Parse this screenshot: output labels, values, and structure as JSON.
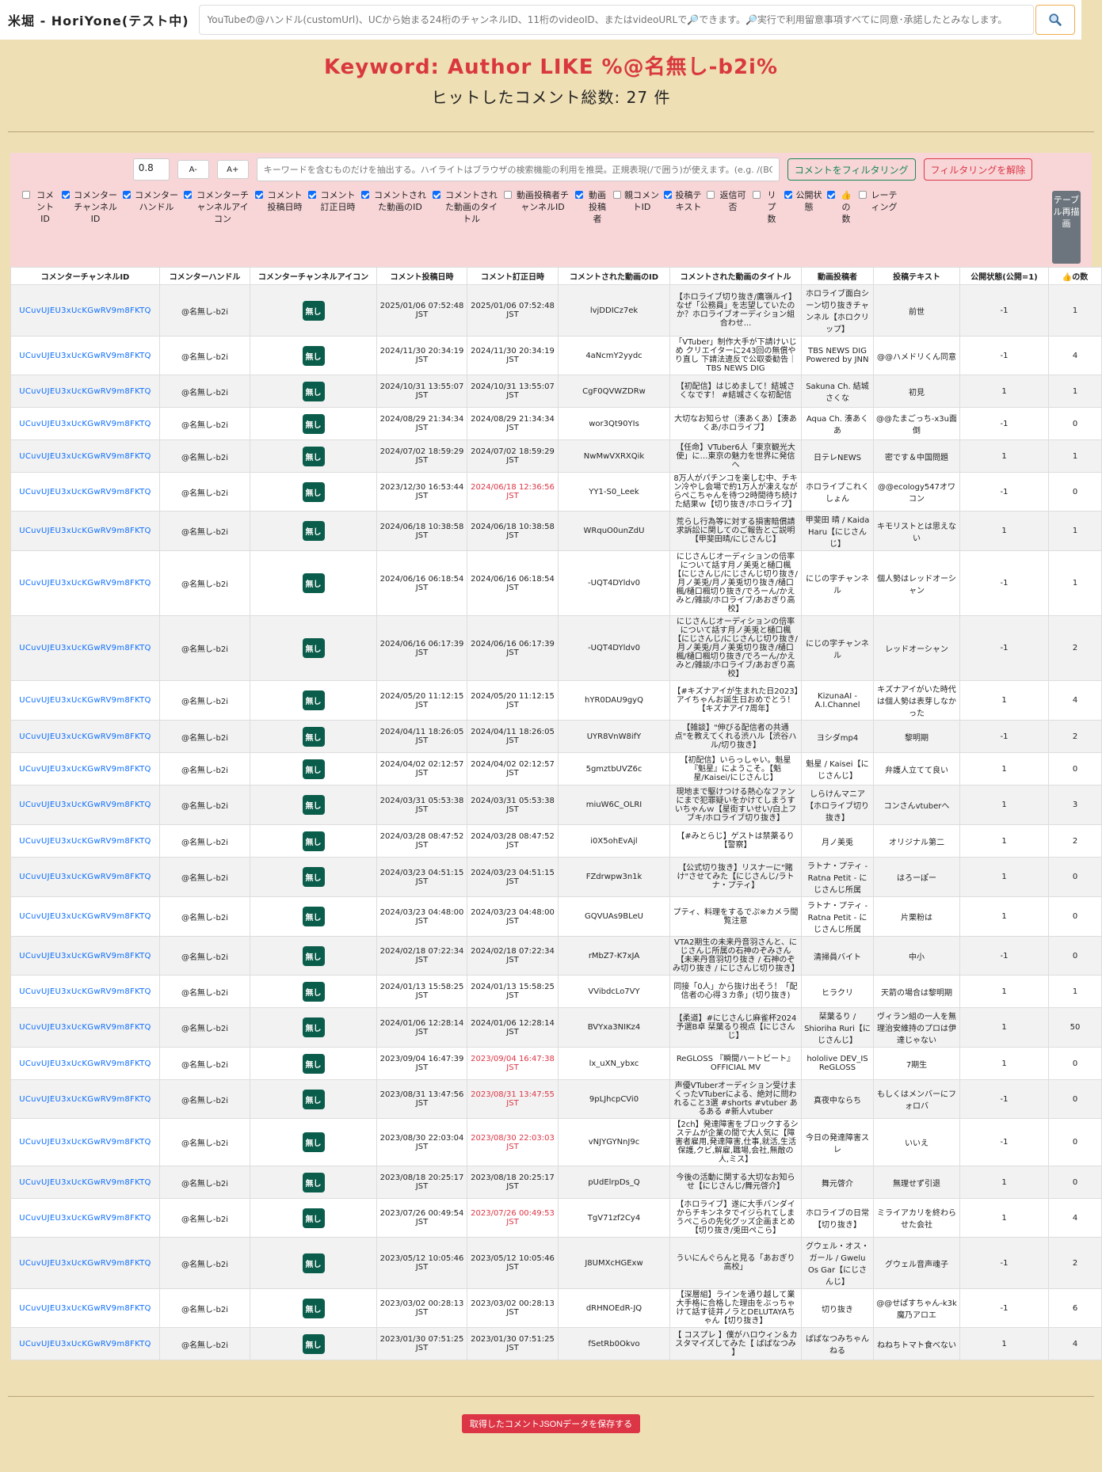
{
  "app": {
    "title": "米堀 - HoriYone(テスト中)",
    "search_placeholder": "YouTubeの@ハンドル(customUrl)、UCから始まる24桁のチャンネルID、11桁のvideoID、またはvideoURLで🔎できます。🔎実行で利用留意事項すべてに同意･承諾したとみなします。"
  },
  "heading": {
    "keyword": "Keyword: Author LIKE %@名無し-b2i%",
    "count": "ヒットしたコメント総数: 27 件"
  },
  "filter": {
    "zoom_value": "0.8",
    "zoom_out_label": "A-",
    "zoom_in_label": "A+",
    "keyword_placeholder": "キーワードを含むものだけを抽出する。ハイライトはブラウザの検索機能の利用を推奨。正規表現(/で囲う)が使えます。(e.g. /(BC)/",
    "filter_button": "コメントをフィルタリング",
    "clear_button": "フィルタリングを解除",
    "redraw_button": "テーブル再描画"
  },
  "columns": [
    {
      "label": "コメントID",
      "checked": false
    },
    {
      "label": "コメンターチャンネルID",
      "checked": true
    },
    {
      "label": "コメンターハンドル",
      "checked": true
    },
    {
      "label": "コメンターチャンネルアイコン",
      "checked": true
    },
    {
      "label": "コメント投稿日時",
      "checked": true
    },
    {
      "label": "コメント訂正日時",
      "checked": true
    },
    {
      "label": "コメントされた動画のID",
      "checked": true
    },
    {
      "label": "コメントされた動画のタイトル",
      "checked": true
    },
    {
      "label": "動画投稿者チャンネルID",
      "checked": false
    },
    {
      "label": "動画投稿者",
      "checked": true
    },
    {
      "label": "親コメントID",
      "checked": false
    },
    {
      "label": "投稿テキスト",
      "checked": true
    },
    {
      "label": "返信可否",
      "checked": false
    },
    {
      "label": "リプ数",
      "checked": false
    },
    {
      "label": "公開状態",
      "checked": true
    },
    {
      "label": "👍の数",
      "checked": true
    },
    {
      "label": "レーティング",
      "checked": false
    }
  ],
  "table_headers": [
    "コメンターチャンネルID",
    "コメンターハンドル",
    "コメンターチャンネルアイコン",
    "コメント投稿日時",
    "コメント訂正日時",
    "コメントされた動画のID",
    "コメントされた動画のタイトル",
    "動画投稿者",
    "投稿テキスト",
    "公開状態(公開=1)",
    "👍の数"
  ],
  "rows": [
    {
      "cid": "UCuvUJEU3xUcKGwRV9m8FKTQ",
      "handle": "@名無し-b2i",
      "icon": "無し",
      "posted": "2025/01/06 07:52:48 JST",
      "edited": "2025/01/06 07:52:48 JST",
      "edited_red": false,
      "vid": "lvjDDICz7ek",
      "title": "【ホロライブ切り抜き/鷹嶺ルイ】なぜ「公務員」を志望していたのか？ホロライブオーディション組合わせ...",
      "author": "ホロライブ面白シーン切り抜きチャンネル【ホロクリップ】",
      "text": "前世",
      "public": "-1",
      "likes": "1"
    },
    {
      "cid": "UCuvUJEU3xUcKGwRV9m8FKTQ",
      "handle": "@名無し-b2i",
      "icon": "無し",
      "posted": "2024/11/30 20:34:19 JST",
      "edited": "2024/11/30 20:34:19 JST",
      "edited_red": false,
      "vid": "4aNcmY2yydc",
      "title": "「VTuber」制作大手が下請けいじめ クリエイターに243回の無償やり直し 下請法違反で公取委勧告｜TBS NEWS DIG",
      "author": "TBS NEWS DIG Powered by JNN",
      "text": "@@ハメドリくん同意",
      "public": "-1",
      "likes": "4"
    },
    {
      "cid": "UCuvUJEU3xUcKGwRV9m8FKTQ",
      "handle": "@名無し-b2i",
      "icon": "無し",
      "posted": "2024/10/31 13:55:07 JST",
      "edited": "2024/10/31 13:55:07 JST",
      "edited_red": false,
      "vid": "CgF0QVWZDRw",
      "title": "【初配信】はじめまして！結城さくなです！ #結城さくな初配信",
      "author": "Sakuna Ch. 結城さくな",
      "text": "初見",
      "public": "1",
      "likes": "1"
    },
    {
      "cid": "UCuvUJEU3xUcKGwRV9m8FKTQ",
      "handle": "@名無し-b2i",
      "icon": "無し",
      "posted": "2024/08/29 21:34:34 JST",
      "edited": "2024/08/29 21:34:34 JST",
      "edited_red": false,
      "vid": "wor3Qt90YIs",
      "title": "大切なお知らせ（湊あくあ）【湊あくあ/ホロライブ】",
      "author": "Aqua Ch. 湊あくあ",
      "text": "@@たまごっち-x3u面倒",
      "public": "-1",
      "likes": "0"
    },
    {
      "cid": "UCuvUJEU3xUcKGwRV9m8FKTQ",
      "handle": "@名無し-b2i",
      "icon": "無し",
      "posted": "2024/07/02 18:59:29 JST",
      "edited": "2024/07/02 18:59:29 JST",
      "edited_red": false,
      "vid": "NwMwVXRXQik",
      "title": "【任命】VTuber6人「東京観光大使」に…東京の魅力を世界に発信へ",
      "author": "日テレNEWS",
      "text": "密です＆中国問題",
      "public": "1",
      "likes": "1"
    },
    {
      "cid": "UCuvUJEU3xUcKGwRV9m8FKTQ",
      "handle": "@名無し-b2i",
      "icon": "無し",
      "posted": "2023/12/30 16:53:44 JST",
      "edited": "2024/06/18 12:36:56 JST",
      "edited_red": true,
      "vid": "YY1-S0_Leek",
      "title": "8万人がパチンコを楽しむ中、チキン冷やし会場で約1万人が凍えながらぺこちゃんを待つ2時間待ち続けた結果ｗ【切り抜き/ホロライブ】",
      "author": "ホロライブこれくしょん",
      "text": "@@ecology547オワコン",
      "public": "-1",
      "likes": "0"
    },
    {
      "cid": "UCuvUJEU3xUcKGwRV9m8FKTQ",
      "handle": "@名無し-b2i",
      "icon": "無し",
      "posted": "2024/06/18 10:38:58 JST",
      "edited": "2024/06/18 10:38:58 JST",
      "edited_red": false,
      "vid": "WRquO0unZdU",
      "title": "荒らし行為等に対する損害賠償請求訴訟に関してのご報告とご説明【甲斐田晴/にじさんじ】",
      "author": "甲斐田 晴 / Kaida Haru【にじさんじ】",
      "text": "キモリストとは思えない",
      "public": "1",
      "likes": "1"
    },
    {
      "cid": "UCuvUJEU3xUcKGwRV9m8FKTQ",
      "handle": "@名無し-b2i",
      "icon": "無し",
      "posted": "2024/06/16 06:18:54 JST",
      "edited": "2024/06/16 06:18:54 JST",
      "edited_red": false,
      "vid": "-UQT4DYldv0",
      "title": "にじさんじオーディションの倍率について話す月ノ美兎と樋口楓【にじさんじ/にじさんじ切り抜き/月ノ美兎/月ノ美兎切り抜き/樋口楓/樋口楓切り抜き/でろーん/かえみと/雑談/ホロライブ/あおぎり高校】",
      "author": "にじの字チャンネル",
      "text": "個人勢はレッドオーシャン",
      "public": "-1",
      "likes": "1"
    },
    {
      "cid": "UCuvUJEU3xUcKGwRV9m8FKTQ",
      "handle": "@名無し-b2i",
      "icon": "無し",
      "posted": "2024/06/16 06:17:39 JST",
      "edited": "2024/06/16 06:17:39 JST",
      "edited_red": false,
      "vid": "-UQT4DYldv0",
      "title": "にじさんじオーディションの倍率について話す月ノ美兎と樋口楓【にじさんじ/にじさんじ切り抜き/月ノ美兎/月ノ美兎切り抜き/樋口楓/樋口楓切り抜き/でろーん/かえみと/雑談/ホロライブ/あおぎり高校】",
      "author": "にじの字チャンネル",
      "text": "レッドオーシャン",
      "public": "-1",
      "likes": "2"
    },
    {
      "cid": "UCuvUJEU3xUcKGwRV9m8FKTQ",
      "handle": "@名無し-b2i",
      "icon": "無し",
      "posted": "2024/05/20 11:12:15 JST",
      "edited": "2024/05/20 11:12:15 JST",
      "edited_red": false,
      "vid": "hYR0DAU9gyQ",
      "title": "【#キズナアイが生まれた日2023】アイちゃんお誕生日おめでとう！【キズナアイ7周年】",
      "author": "KizunaAI - A.I.Channel",
      "text": "キズナアイがいた時代は個人勢は表芽しなかった",
      "public": "1",
      "likes": "4"
    },
    {
      "cid": "UCuvUJEU3xUcKGwRV9m8FKTQ",
      "handle": "@名無し-b2i",
      "icon": "無し",
      "posted": "2024/04/11 18:26:05 JST",
      "edited": "2024/04/11 18:26:05 JST",
      "edited_red": false,
      "vid": "UYR8VnW8ifY",
      "title": "【雑談】\"伸びる配信者の共通点\"を教えてくれる渋ハル【渋谷ハル/切り抜き】",
      "author": "ヨシダmp4",
      "text": "黎明期",
      "public": "-1",
      "likes": "2"
    },
    {
      "cid": "UCuvUJEU3xUcKGwRV9m8FKTQ",
      "handle": "@名無し-b2i",
      "icon": "無し",
      "posted": "2024/04/02 02:12:57 JST",
      "edited": "2024/04/02 02:12:57 JST",
      "edited_red": false,
      "vid": "5gmztbUVZ6c",
      "title": "【初配信】いらっしゃい。魁星『魁星』にようこそ。【魁星/Kaisei/にじさんじ】",
      "author": "魁星 / Kaisei【にじさんじ】",
      "text": "弁護人立てて良い",
      "public": "1",
      "likes": "0"
    },
    {
      "cid": "UCuvUJEU3xUcKGwRV9m8FKTQ",
      "handle": "@名無し-b2i",
      "icon": "無し",
      "posted": "2024/03/31 05:53:38 JST",
      "edited": "2024/03/31 05:53:38 JST",
      "edited_red": false,
      "vid": "miuW6C_OLRI",
      "title": "現地まで駆けつける熱心なファンにまで犯罪疑いをかけてしまうすいちゃんｗ【星街すいせい/白上フブキ/ホロライブ切り抜き】",
      "author": "しらけんマニア【ホロライブ切り抜き】",
      "text": "コンさんvtuberへ",
      "public": "1",
      "likes": "3"
    },
    {
      "cid": "UCuvUJEU3xUcKGwRV9m8FKTQ",
      "handle": "@名無し-b2i",
      "icon": "無し",
      "posted": "2024/03/28 08:47:52 JST",
      "edited": "2024/03/28 08:47:52 JST",
      "edited_red": false,
      "vid": "i0X5ohEvAjl",
      "title": "【#みとらじ】ゲストは禁薬るり【警察】",
      "author": "月ノ美兎",
      "text": "オリジナル第二",
      "public": "1",
      "likes": "2"
    },
    {
      "cid": "UCuvUJEU3xUcKGwRV9m8FKTQ",
      "handle": "@名無し-b2i",
      "icon": "無し",
      "posted": "2024/03/23 04:51:15 JST",
      "edited": "2024/03/23 04:51:15 JST",
      "edited_red": false,
      "vid": "FZdrwpw3n1k",
      "title": "【公式切り抜き】リスナーに\"賭け\"させてみた【にじさんじ/ラトナ・プティ】",
      "author": "ラトナ・プティ - Ratna Petit - にじさんじ所属",
      "text": "はろーぽー",
      "public": "1",
      "likes": "0"
    },
    {
      "cid": "UCuvUJEU3xUcKGwRV9m8FKTQ",
      "handle": "@名無し-b2i",
      "icon": "無し",
      "posted": "2024/03/23 04:48:00 JST",
      "edited": "2024/03/23 04:48:00 JST",
      "edited_red": false,
      "vid": "GQVUAs9BLeU",
      "title": "プティ、料理をするでぷ※カメラ間覧注意",
      "author": "ラトナ・プティ - Ratna Petit - にじさんじ所属",
      "text": "片栗粉は",
      "public": "1",
      "likes": "0"
    },
    {
      "cid": "UCuvUJEU3xUcKGwRV9m8FKTQ",
      "handle": "@名無し-b2i",
      "icon": "無し",
      "posted": "2024/02/18 07:22:34 JST",
      "edited": "2024/02/18 07:22:34 JST",
      "edited_red": false,
      "vid": "rMbZ7-K7xJA",
      "title": "VTA2期生の未来丹音羽さんと、にじさんじ所属の石神のぞみさん【未来丹音羽切り抜き / 石神のぞみ切り抜き / にじさんじ切り抜き】",
      "author": "清掃員バイト",
      "text": "中小",
      "public": "-1",
      "likes": "0"
    },
    {
      "cid": "UCuvUJEU3xUcKGwRV9m8FKTQ",
      "handle": "@名無し-b2i",
      "icon": "無し",
      "posted": "2024/01/13 15:58:25 JST",
      "edited": "2024/01/13 15:58:25 JST",
      "edited_red": false,
      "vid": "VVibdcLo7VY",
      "title": "同接「0人」から抜け出そう！「配信者の心得３カ条」(切り抜き)",
      "author": "ヒラクリ",
      "text": "天箭の場合は黎明期",
      "public": "1",
      "likes": "1"
    },
    {
      "cid": "UCuvUJEU3xUcKGwRV9m8FKTQ",
      "handle": "@名無し-b2i",
      "icon": "無し",
      "posted": "2024/01/06 12:28:14 JST",
      "edited": "2024/01/06 12:28:14 JST",
      "edited_red": false,
      "vid": "BVYxa3NIKz4",
      "title": "【柔道】#にじさんじ麻雀杯2024 予選B卓 栞葉るり視点【にじさんじ】",
      "author": "栞葉るり / Shioriha Ruri【にじさんじ】",
      "text": "ヴィラン組の一人を無理治安維持のプロは伊達じゃない",
      "public": "1",
      "likes": "50"
    },
    {
      "cid": "UCuvUJEU3xUcKGwRV9m8FKTQ",
      "handle": "@名無し-b2i",
      "icon": "無し",
      "posted": "2023/09/04 16:47:39 JST",
      "edited": "2023/09/04 16:47:38 JST",
      "edited_red": true,
      "vid": "lx_uXN_ybxc",
      "title": "ReGLOSS 『瞬間ハートビート』 OFFICIAL MV",
      "author": "hololive DEV_IS ReGLOSS",
      "text": "7期生",
      "public": "1",
      "likes": "0"
    },
    {
      "cid": "UCuvUJEU3xUcKGwRV9m8FKTQ",
      "handle": "@名無し-b2i",
      "icon": "無し",
      "posted": "2023/08/31 13:47:56 JST",
      "edited": "2023/08/31 13:47:55 JST",
      "edited_red": true,
      "vid": "9pLJhcpCVi0",
      "title": "声優VTuberオーディション受けまくったVTuberによる、絶対に問われること3選 #shorts #vtuber あるある #新人vtuber",
      "author": "真夜中ならち",
      "text": "もしくはメンバーにフォロバ",
      "public": "-1",
      "likes": "0"
    },
    {
      "cid": "UCuvUJEU3xUcKGwRV9m8FKTQ",
      "handle": "@名無し-b2i",
      "icon": "無し",
      "posted": "2023/08/30 22:03:04 JST",
      "edited": "2023/08/30 22:03:03 JST",
      "edited_red": true,
      "vid": "vNJYGYNnJ9c",
      "title": "【2ch】発達障害をブロックするシステムが企業の間で大人気に【障害者雇用,発達障害,仕事,就活,生活保護,クビ,解雇,職場,会社,無敵の人,ミス】",
      "author": "今日の発達障害スレ",
      "text": "いいえ",
      "public": "-1",
      "likes": "0"
    },
    {
      "cid": "UCuvUJEU3xUcKGwRV9m8FKTQ",
      "handle": "@名無し-b2i",
      "icon": "無し",
      "posted": "2023/08/18 20:25:17 JST",
      "edited": "2023/08/18 20:25:17 JST",
      "edited_red": false,
      "vid": "pUdElrpDs_Q",
      "title": "今後の活動に関する大切なお知らせ【にじさんじ/舞元啓介】",
      "author": "舞元啓介",
      "text": "無理せず引退",
      "public": "1",
      "likes": "0"
    },
    {
      "cid": "UCuvUJEU3xUcKGwRV9m8FKTQ",
      "handle": "@名無し-b2i",
      "icon": "無し",
      "posted": "2023/07/26 00:49:54 JST",
      "edited": "2023/07/26 00:49:53 JST",
      "edited_red": true,
      "vid": "TgV71zf2Cy4",
      "title": "【ホロライブ】遂に大手バンダイからチキンネタでイジられてしまうぺこらの先化グッズ企画まとめ【切り抜き/兎田ぺこら】",
      "author": "ホロライブの日常【切り抜き】",
      "text": "ミライアカリを終わらせた会社",
      "public": "1",
      "likes": "4"
    },
    {
      "cid": "UCuvUJEU3xUcKGwRV9m8FKTQ",
      "handle": "@名無し-b2i",
      "icon": "無し",
      "posted": "2023/05/12 10:05:46 JST",
      "edited": "2023/05/12 10:05:46 JST",
      "edited_red": false,
      "vid": "J8UMXcHGExw",
      "title": "ういにんぐらんと見る「あおぎり高校」",
      "author": "グウェル・オス・ガール / Gwelu Os Gar【にじさんじ】",
      "text": "グウェル音声魂子",
      "public": "-1",
      "likes": "2"
    },
    {
      "cid": "UCuvUJEU3xUcKGwRV9m8FKTQ",
      "handle": "@名無し-b2i",
      "icon": "無し",
      "posted": "2023/03/02 00:28:13 JST",
      "edited": "2023/03/02 00:28:13 JST",
      "edited_red": false,
      "vid": "dRHNOEdR-JQ",
      "title": "【深層組】ラインを通り越して業大手格に合格した理由をぶっちゃけて話す徒井ノラとDELUTAYAちゃん【切り抜き】",
      "author": "切り抜き",
      "text": "@@せぱすちゃん-k3k 魔乃アロエ",
      "public": "-1",
      "likes": "6"
    },
    {
      "cid": "UCuvUJEU3xUcKGwRV9m8FKTQ",
      "handle": "@名無し-b2i",
      "icon": "無し",
      "posted": "2023/01/30 07:51:25 JST",
      "edited": "2023/01/30 07:51:25 JST",
      "edited_red": false,
      "vid": "fSetRb0Okvo",
      "title": "【 コスプレ 】僕がハロウィン＆カスタマイズしてみた【 ぱぱなつみ 】",
      "author": "ぱぱなつみちゃんねる",
      "text": "ねねちトマト食べない",
      "public": "1",
      "likes": "4"
    }
  ],
  "save_button": "取得したコメントJSONデータを保存する"
}
